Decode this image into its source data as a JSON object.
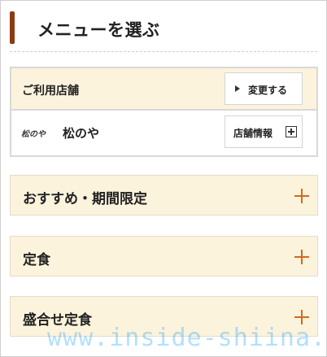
{
  "header": {
    "title": "メニューを選ぶ"
  },
  "store": {
    "label": "ご利用店舗",
    "change_button": "変更する",
    "logo_text": "松のや",
    "name": "松のや",
    "info_button": "店舗情報"
  },
  "categories": [
    {
      "label": "おすすめ・期間限定"
    },
    {
      "label": "定食"
    },
    {
      "label": "盛合せ定食"
    }
  ],
  "watermark": "www.inside-shiina.com",
  "colors": {
    "accent_bar": "#8b3a14",
    "panel_bg": "#fcf3dc",
    "plus_icon": "#d2691e"
  }
}
